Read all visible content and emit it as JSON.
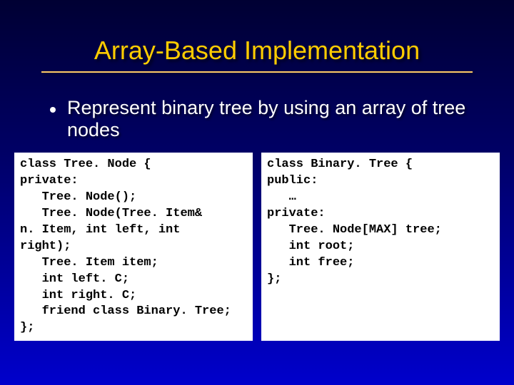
{
  "title": "Array-Based Implementation",
  "bullet": "Represent binary tree by using an array of tree nodes",
  "code_left": "class Tree. Node {\nprivate:\n   Tree. Node();\n   Tree. Node(Tree. Item&\nn. Item, int left, int\nright);\n   Tree. Item item;\n   int left. C;\n   int right. C;\n   friend class Binary. Tree;\n};",
  "code_right": "class Binary. Tree {\npublic:\n   …\nprivate:\n   Tree. Node[MAX] tree;\n   int root;\n   int free;\n};"
}
